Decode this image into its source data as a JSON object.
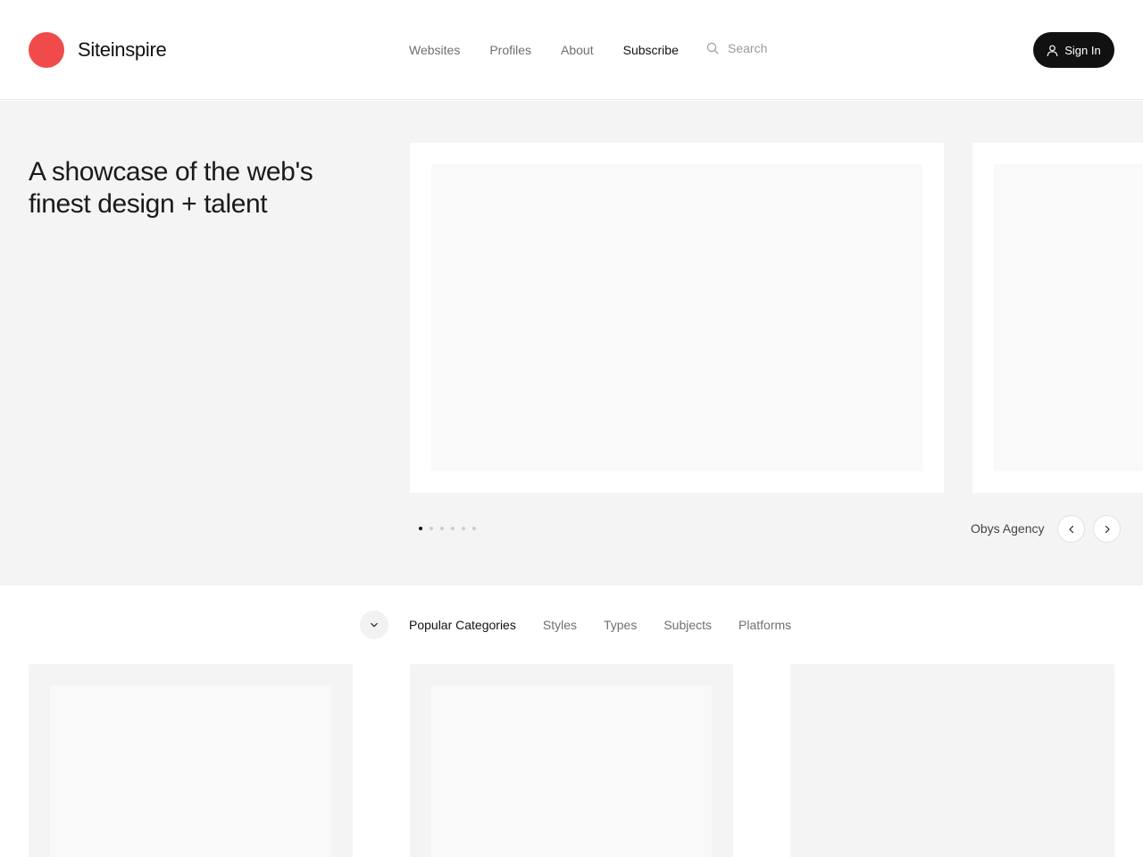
{
  "brand": {
    "name": "Siteinspire",
    "logo_color": "#f04a4a"
  },
  "nav": {
    "items": [
      "Websites",
      "Profiles",
      "About",
      "Subscribe"
    ],
    "active": "Subscribe"
  },
  "search": {
    "placeholder": "Search",
    "value": ""
  },
  "auth": {
    "signin_label": "Sign In"
  },
  "hero": {
    "title": "A showcase of the web's finest design + talent",
    "slide_caption": "Obys Agency",
    "slide_count": 6,
    "active_slide": 1
  },
  "categories": {
    "items": [
      "Popular Categories",
      "Styles",
      "Types",
      "Subjects",
      "Platforms"
    ],
    "active": "Popular Categories"
  },
  "icons": {
    "search": "search-icon",
    "user": "user-icon",
    "prev": "chevron-left-icon",
    "next": "chevron-right-icon",
    "toggle": "chevron-down-icon"
  }
}
